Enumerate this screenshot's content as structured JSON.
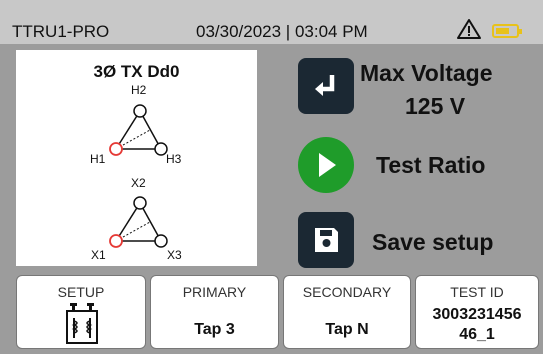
{
  "header": {
    "device_name": "TTRU1-PRO",
    "datetime": "03/30/2023 | 03:04 PM",
    "warning_icon": "warning-triangle-icon",
    "battery_icon": "battery-icon",
    "battery_color": "#e8c21a"
  },
  "diagram": {
    "title": "3Ø TX Dd0",
    "primary_nodes": [
      "H1",
      "H2",
      "H3"
    ],
    "secondary_nodes": [
      "X1",
      "X2",
      "X3"
    ],
    "highlight_color": "#e53935"
  },
  "actions": {
    "max_voltage_label": "Max Voltage",
    "max_voltage_value": "125 V",
    "max_voltage_icon": "enter-return-icon",
    "test_ratio_label": "Test Ratio",
    "test_ratio_icon": "play-icon",
    "test_ratio_color": "#1f9c2a",
    "save_setup_label": "Save setup",
    "save_setup_icon": "save-disk-icon"
  },
  "tabs": [
    {
      "label": "SETUP",
      "icon": "transformer-icon"
    },
    {
      "label": "PRIMARY",
      "value": "Tap 3"
    },
    {
      "label": "SECONDARY",
      "value": "Tap N"
    },
    {
      "label": "TEST ID",
      "value_line1": "3003231456",
      "value_line2": "46_1"
    }
  ]
}
